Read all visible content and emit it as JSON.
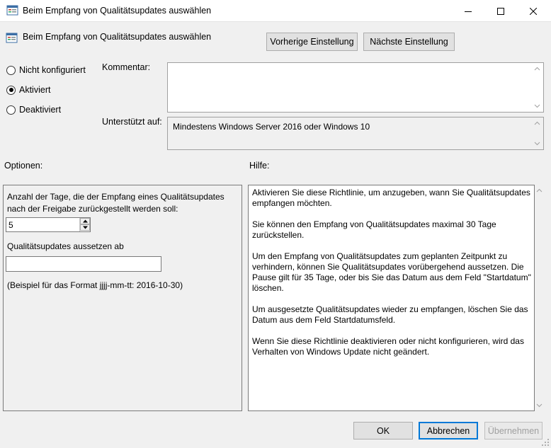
{
  "window": {
    "title": "Beim Empfang von Qualitätsupdates auswählen"
  },
  "header": {
    "policy_title": "Beim Empfang von Qualitätsupdates auswählen",
    "prev_label": "Vorherige Einstellung",
    "next_label": "Nächste Einstellung"
  },
  "state": {
    "options": [
      {
        "label": "Nicht konfiguriert",
        "checked": false
      },
      {
        "label": "Aktiviert",
        "checked": true
      },
      {
        "label": "Deaktiviert",
        "checked": false
      }
    ]
  },
  "comment": {
    "label": "Kommentar:",
    "value": ""
  },
  "supported": {
    "label": "Unterstützt auf:",
    "value": "Mindestens Windows Server 2016 oder Windows 10"
  },
  "options_section": {
    "label": "Optionen:",
    "days_label": "Anzahl der Tage, die der Empfang eines Qualitätsupdates nach der Freigabe zurückgestellt werden soll:",
    "days_value": "5",
    "pause_label": "Qualitätsupdates aussetzen ab",
    "pause_value": "",
    "format_hint": "(Beispiel für das Format jjjj-mm-tt: 2016-10-30)"
  },
  "help_section": {
    "label": "Hilfe:",
    "paragraphs": [
      "Aktivieren Sie diese Richtlinie, um anzugeben, wann Sie Qualitätsupdates empfangen möchten.",
      "Sie können den Empfang von Qualitätsupdates maximal 30 Tage zurückstellen.",
      "Um den Empfang von Qualitätsupdates zum geplanten Zeitpunkt zu verhindern, können Sie Qualitätsupdates vorübergehend aussetzen. Die Pause gilt für 35 Tage, oder bis Sie das Datum aus dem Feld \"Startdatum\" löschen.",
      "Um ausgesetzte Qualitätsupdates wieder zu empfangen, löschen Sie das Datum aus dem Feld Startdatumsfeld.",
      "Wenn Sie diese Richtlinie deaktivieren oder nicht konfigurieren, wird das Verhalten von Windows Update nicht geändert."
    ]
  },
  "footer": {
    "ok_label": "OK",
    "cancel_label": "Abbrechen",
    "apply_label": "Übernehmen"
  },
  "icons": {
    "window": "policy-settings-icon",
    "minimize": "minimize-icon",
    "maximize": "maximize-icon",
    "close": "close-icon"
  },
  "colors": {
    "focus_border": "#0078d7",
    "disabled_text": "#a0a0a0"
  }
}
